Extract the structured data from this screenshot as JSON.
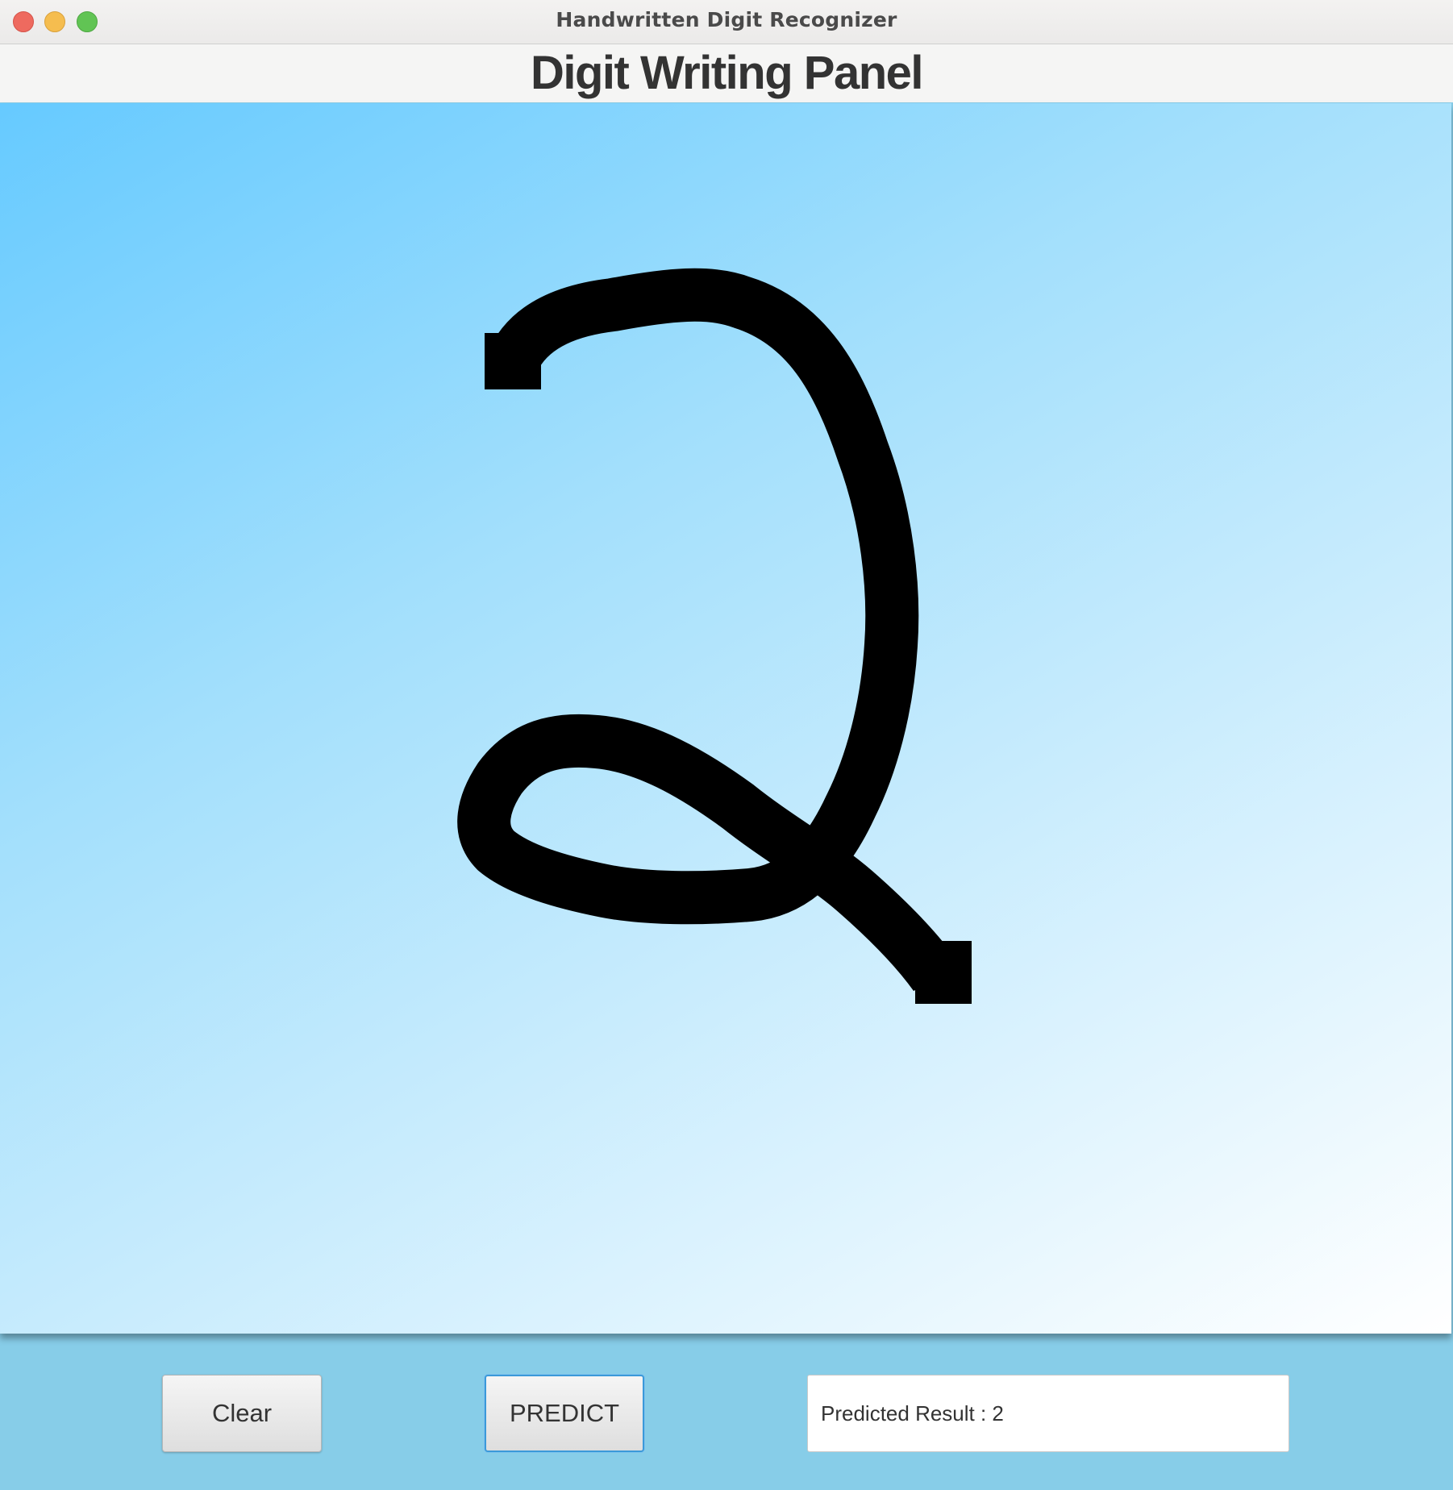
{
  "window": {
    "title": "Handwritten Digit Recognizer"
  },
  "panel": {
    "title": "Digit Writing Panel"
  },
  "canvas": {
    "drawn_digit": "2",
    "stroke_color": "#000000",
    "gradient_colors": [
      "#66caff",
      "#ffffff"
    ]
  },
  "controls": {
    "clear_label": "Clear",
    "predict_label": "PREDICT",
    "result_text": "Predicted Result : 2"
  },
  "colors": {
    "footer_background": "#87cde8",
    "title_bar": "#ebeae9",
    "close": "#ee6a5f",
    "minimize": "#f5bd4f",
    "maximize": "#61c454"
  }
}
